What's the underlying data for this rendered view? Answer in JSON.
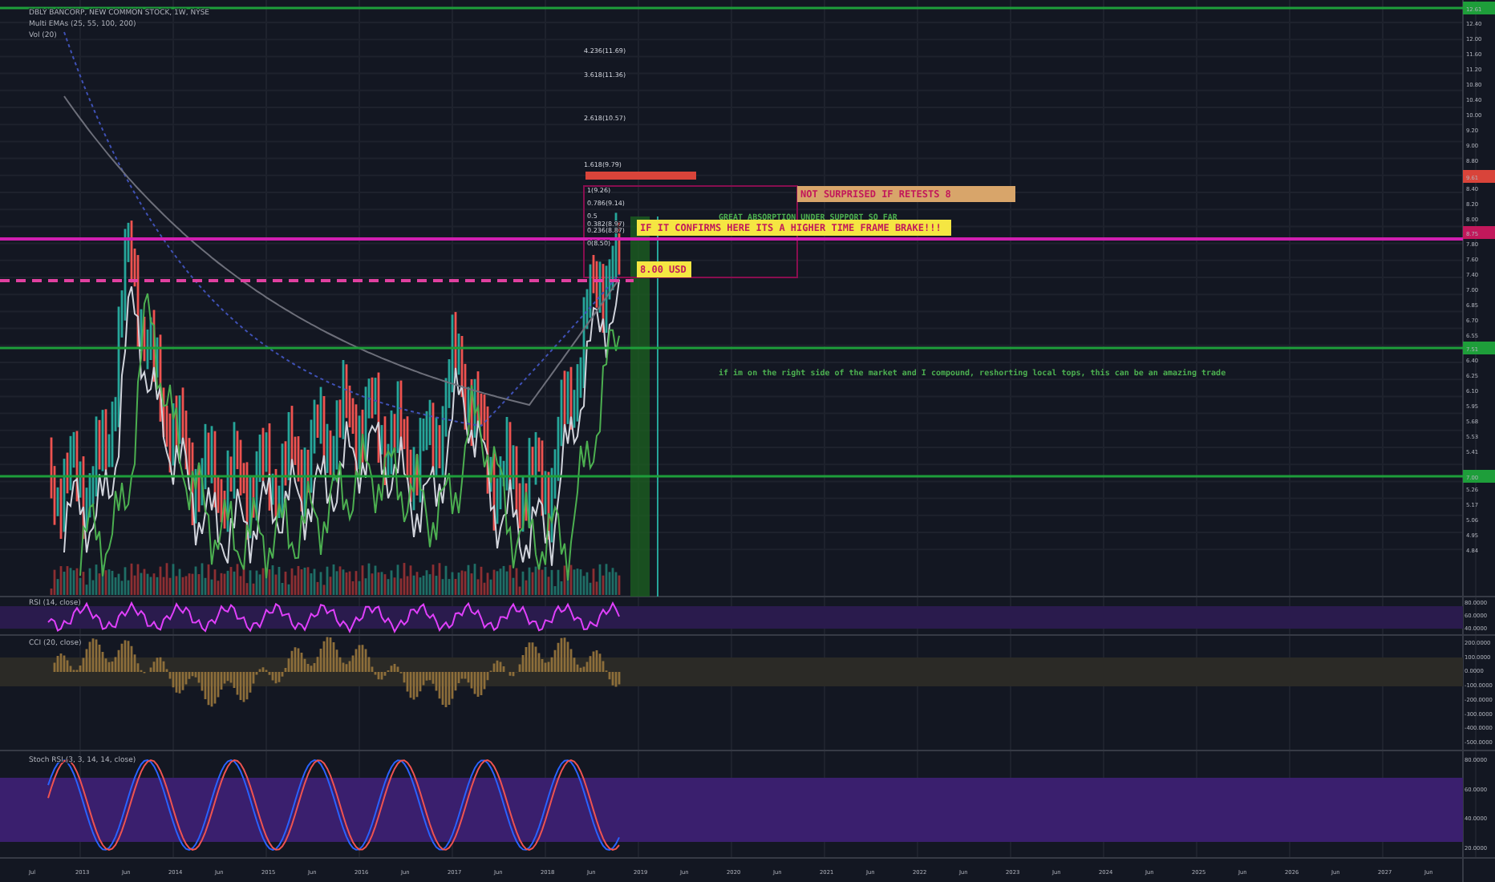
{
  "legend": [
    "DBLY BANCORP, NEW COMMON STOCK, 1W, NYSE",
    "Multi EMAs (25, 55, 100, 200)",
    "Vol (20)"
  ],
  "fib_levels": [
    "4.236(11.69)",
    "3.618(11.36)",
    "2.618(10.57)",
    "1.618(9.79)",
    "1(9.26)",
    "0.786(9.14)",
    "0.5",
    "0.382(8.97)",
    "0.236(8.87)",
    "0(8.50)"
  ],
  "annotations": [
    {
      "kind": "banner-orange",
      "text": "NOT SURPRISED IF RETESTS 8"
    },
    {
      "kind": "text-green",
      "text": "GREAT ABSORPTION UNDER SUPPORT SO FAR"
    },
    {
      "kind": "banner-yellow",
      "text": "IF IT CONFIRMS HERE ITS A HIGHER TIME FRAME BRAKE!!!"
    },
    {
      "kind": "banner-yellow",
      "text": "8.00 USD"
    },
    {
      "kind": "text-green",
      "text": "if im on the right side of the market and I compound, reshorting local tops, this can be an amazing trade"
    }
  ],
  "price_axis": [
    "12.40",
    "12.00",
    "11.60",
    "11.20",
    "10.80",
    "10.40",
    "10.00",
    "9.20",
    "9.00",
    "8.80",
    "8.40",
    "8.20",
    "8.00",
    "7.80",
    "7.60",
    "7.40",
    "7.00",
    "6.85",
    "6.70",
    "6.55",
    "6.40",
    "6.25",
    "6.10",
    "5.95",
    "5.68",
    "5.53",
    "5.41",
    "5.26",
    "5.17",
    "5.06",
    "4.95",
    "4.84"
  ],
  "price_badges": [
    {
      "text": "12.61",
      "color": "#1e9e3a"
    },
    {
      "text": "9.61",
      "color": "#d9443a"
    },
    {
      "text": "8.75",
      "color": "#c2185b"
    },
    {
      "text": "7.51",
      "color": "#1e9e3a"
    },
    {
      "text": "7.00",
      "color": "#1e9e3a"
    }
  ],
  "panes": [
    {
      "label": "RSI (14, close)",
      "axis": [
        "80.0000",
        "60.0000",
        "40.0000"
      ]
    },
    {
      "label": "CCI (20, close)",
      "axis": [
        "200.0000",
        "100.0000",
        "0.0000",
        "-100.0000",
        "-200.0000",
        "-300.0000",
        "-400.0000",
        "-500.0000"
      ]
    },
    {
      "label": "Stoch RSI (3, 3, 14, 14, close)",
      "axis": [
        "80.0000",
        "60.0000",
        "40.0000",
        "20.0000"
      ]
    }
  ],
  "time_axis": [
    "Jul",
    "2013",
    "Jun",
    "2014",
    "Jun",
    "2015",
    "Jun",
    "2016",
    "Jun",
    "2017",
    "Jun",
    "2018",
    "Jun",
    "2019",
    "Jun",
    "2020",
    "Jun",
    "2021",
    "Jun",
    "2022",
    "Jun",
    "2023",
    "Jun",
    "2024",
    "Jun",
    "2025",
    "Jun",
    "2026",
    "Jun",
    "2027",
    "Jun"
  ]
}
